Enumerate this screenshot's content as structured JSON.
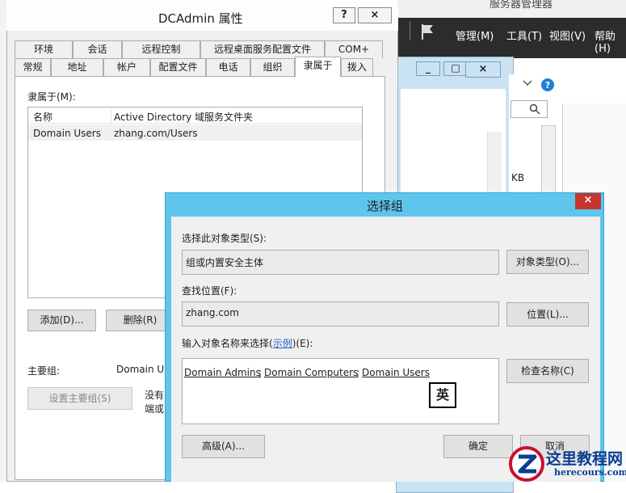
{
  "background_app": {
    "title": "服务器管理器",
    "menu": [
      "管理(M)",
      "工具(T)",
      "视图(V)",
      "帮助(H)"
    ],
    "right_pane_text": "KB",
    "inner_window_buttons": [
      "_",
      "□",
      "×"
    ]
  },
  "properties_dialog": {
    "title": "DCAdmin 属性",
    "help_button": "?",
    "close_button": "×",
    "tabs_row1": [
      "环境",
      "会话",
      "远程控制",
      "远程桌面服务配置文件",
      "COM+"
    ],
    "tabs_row2": [
      "常规",
      "地址",
      "帐户",
      "配置文件",
      "电话",
      "组织",
      "隶属于",
      "拨入"
    ],
    "active_tab": "隶属于",
    "member_of_label": "隶属于(M):",
    "columns": [
      "名称",
      "Active Directory 域服务文件夹"
    ],
    "rows": [
      {
        "name": "Domain Users",
        "folder": "zhang.com/Users"
      }
    ],
    "add_button": "添加(D)...",
    "remove_button": "删除(R)",
    "primary_group_label": "主要组:",
    "primary_group_value": "Domain U",
    "set_primary_button": "设置主要组(S)",
    "note_line1": "没有",
    "note_line2": "端或"
  },
  "select_group_dialog": {
    "title": "选择组",
    "close_button": "×",
    "object_type_label": "选择此对象类型(S):",
    "object_type_value": "组或内置安全主体",
    "object_type_button": "对象类型(O)...",
    "location_label": "查找位置(F):",
    "location_value": "zhang.com",
    "location_button": "位置(L)...",
    "names_label_prefix": "输入对象名称来选择(",
    "names_label_link": "示例",
    "names_label_suffix": ")(E):",
    "names": [
      "Domain Admins",
      "Domain Computers",
      "Domain Users"
    ],
    "separator": ";",
    "check_names_button": "检查名称(C)",
    "advanced_button": "高级(A)...",
    "ok_button": "确定",
    "cancel_button": "取消",
    "ime_indicator": "英"
  },
  "watermark": {
    "zh": "这里教程网",
    "en": "herecours.com"
  }
}
